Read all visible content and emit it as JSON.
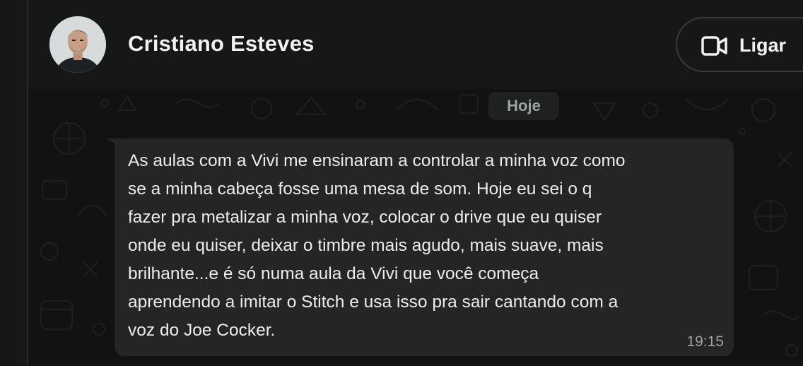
{
  "header": {
    "contact_name": "Cristiano Esteves",
    "call_label": "Ligar"
  },
  "chat": {
    "date_label": "Hoje",
    "message": {
      "lines": [
        "As aulas com a Vivi me ensinaram a controlar a minha voz como",
        "se a minha cabeça fosse uma mesa de som. Hoje eu sei o q",
        "fazer pra metalizar a minha voz, colocar o drive que eu quiser",
        "onde eu quiser, deixar o timbre mais agudo, mais suave, mais",
        "brilhante...e é só numa aula da Vivi que você começa",
        "aprendendo a imitar o Stitch e usa isso pra sair cantando com a",
        "voz do Joe Cocker."
      ],
      "time": "19:15"
    }
  },
  "icons": {
    "call": "video-camera-icon",
    "avatar": "contact-avatar"
  },
  "colors": {
    "background": "#161717",
    "chat_background": "#111313",
    "bubble": "#242626",
    "text": "#ececec",
    "muted": "#9ea3a3"
  }
}
